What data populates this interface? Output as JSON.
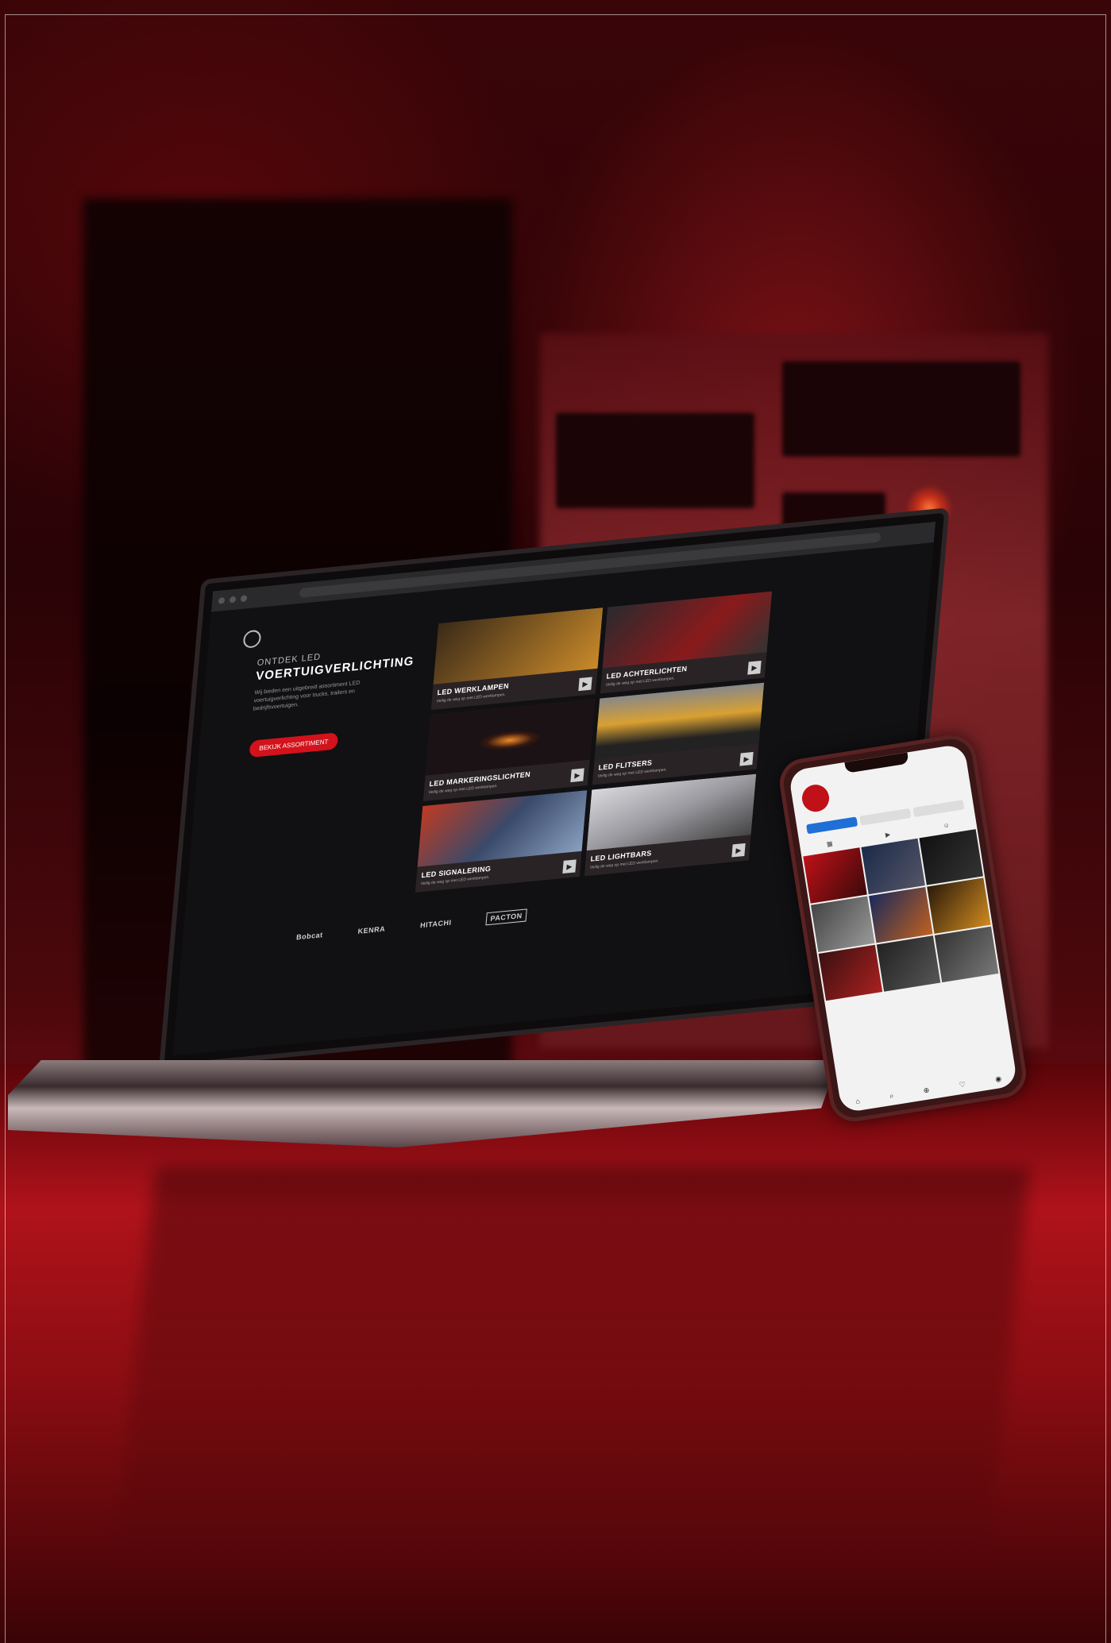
{
  "laptop_site": {
    "browser_title": "",
    "hero": {
      "kicker": "ONTDEK LED",
      "title": "VOERTUIGVERLICHTING",
      "text": "Wij bieden een uitgebreid assortiment LED voertuigverlichting voor trucks, trailers en bedrijfsvoertuigen.",
      "button_label": "BEKIJK ASSORTIMENT"
    },
    "cards": [
      {
        "title": "LED WERKLAMPEN",
        "sub": "Veilig de weg op met LED werklampen.",
        "play": "▶",
        "color": "#c98a2a"
      },
      {
        "title": "LED ACHTERLICHTEN",
        "sub": "Veilig de weg op met LED werklampen.",
        "play": "▶",
        "color": "#8a1a1c"
      },
      {
        "title": "LED MARKERINGSLICHTEN",
        "sub": "Veilig de weg op met LED werklampen.",
        "play": "▶",
        "color": "#d46a18"
      },
      {
        "title": "LED FLITSERS",
        "sub": "Veilig de weg op met LED werklampen.",
        "play": "▶",
        "color": "#d9a032"
      },
      {
        "title": "LED SIGNALERING",
        "sub": "Veilig de weg op met LED werklampen.",
        "play": "▶",
        "color": "#3a4a6a"
      },
      {
        "title": "LED LIGHTBARS",
        "sub": "Veilig de weg op met LED werklampen.",
        "play": "▶",
        "color": "#9a9aa0"
      }
    ],
    "logos": [
      "",
      "Bobcat",
      "KENRA",
      "HITACHI",
      "PACTON",
      ""
    ]
  },
  "phone_app": {
    "time": "",
    "username": "",
    "avatar_text": "",
    "stats": [
      {
        "num": "",
        "label": ""
      },
      {
        "num": "",
        "label": ""
      },
      {
        "num": "",
        "label": ""
      }
    ],
    "bio": "",
    "buttons": [
      "",
      "",
      ""
    ],
    "tabs": [
      "▦",
      "▶",
      "☺"
    ],
    "nav": [
      "⌂",
      "⌕",
      "⊕",
      "♡",
      "◉"
    ]
  }
}
